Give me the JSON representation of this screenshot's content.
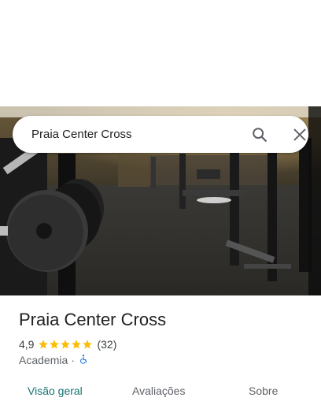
{
  "search": {
    "query": "Praia Center Cross"
  },
  "place": {
    "name": "Praia Center Cross",
    "rating": "4,9",
    "stars": 5,
    "review_count": "(32)",
    "category": "Academia",
    "separator": "·"
  },
  "tabs": [
    {
      "label": "Visão geral"
    },
    {
      "label": "Avaliações"
    },
    {
      "label": "Sobre"
    }
  ],
  "colors": {
    "accent_tab": "#1a7373",
    "star": "#fbbc04",
    "accessibility": "#1a73e8"
  },
  "icons": {
    "search": "search-icon",
    "close": "close-icon",
    "accessibility": "wheelchair-icon"
  }
}
